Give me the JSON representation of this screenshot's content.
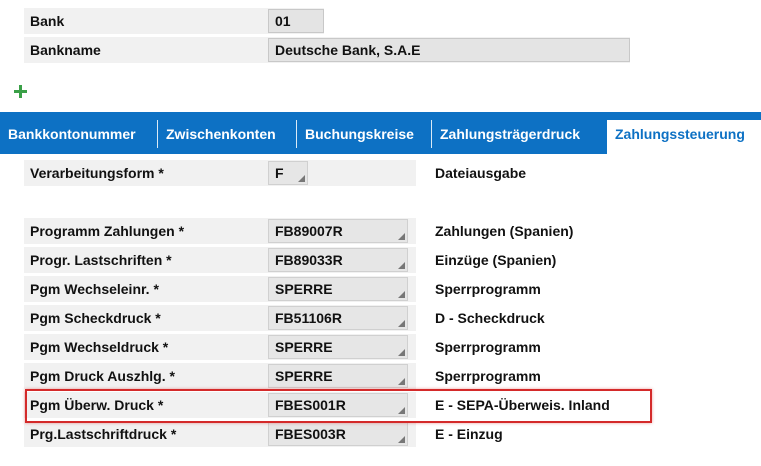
{
  "header": {
    "bank_label": "Bank",
    "bank_value": "01",
    "bankname_label": "Bankname",
    "bankname_value": "Deutsche Bank, S.A.E"
  },
  "tabs": [
    {
      "label": "Bankkontonummer",
      "active": false
    },
    {
      "label": "Zwischenkonten",
      "active": false
    },
    {
      "label": "Buchungskreise",
      "active": false
    },
    {
      "label": "Zahlungsträgerdruck",
      "active": false
    },
    {
      "label": "Zahlungssteuerung",
      "active": true
    }
  ],
  "colors": {
    "tab_bar": "#0d71c4",
    "highlight": "#d42a2a",
    "add_icon": "#3aa047"
  },
  "form": {
    "verarbeitungsform": {
      "label": "Verarbeitungsform *",
      "value": "F",
      "description": "Dateiausgabe"
    },
    "rows": [
      {
        "label": "Programm Zahlungen *",
        "value": "FB89007R",
        "description": "Zahlungen (Spanien)"
      },
      {
        "label": "Progr. Lastschriften *",
        "value": "FB89033R",
        "description": "Einzüge (Spanien)"
      },
      {
        "label": "Pgm Wechseleinr. *",
        "value": "SPERRE",
        "description": "Sperrprogramm"
      },
      {
        "label": "Pgm Scheckdruck *",
        "value": "FB51106R",
        "description": "D - Scheckdruck"
      },
      {
        "label": "Pgm Wechseldruck *",
        "value": "SPERRE",
        "description": "Sperrprogramm"
      },
      {
        "label": "Pgm Druck Auszhlg. *",
        "value": "SPERRE",
        "description": "Sperrprogramm"
      },
      {
        "label": "Pgm Überw. Druck *",
        "value": "FBES001R",
        "description": "E - SEPA-Überweis. Inland"
      },
      {
        "label": "Prg.Lastschriftdruck *",
        "value": "FBES003R",
        "description": "E - Einzug"
      }
    ]
  }
}
